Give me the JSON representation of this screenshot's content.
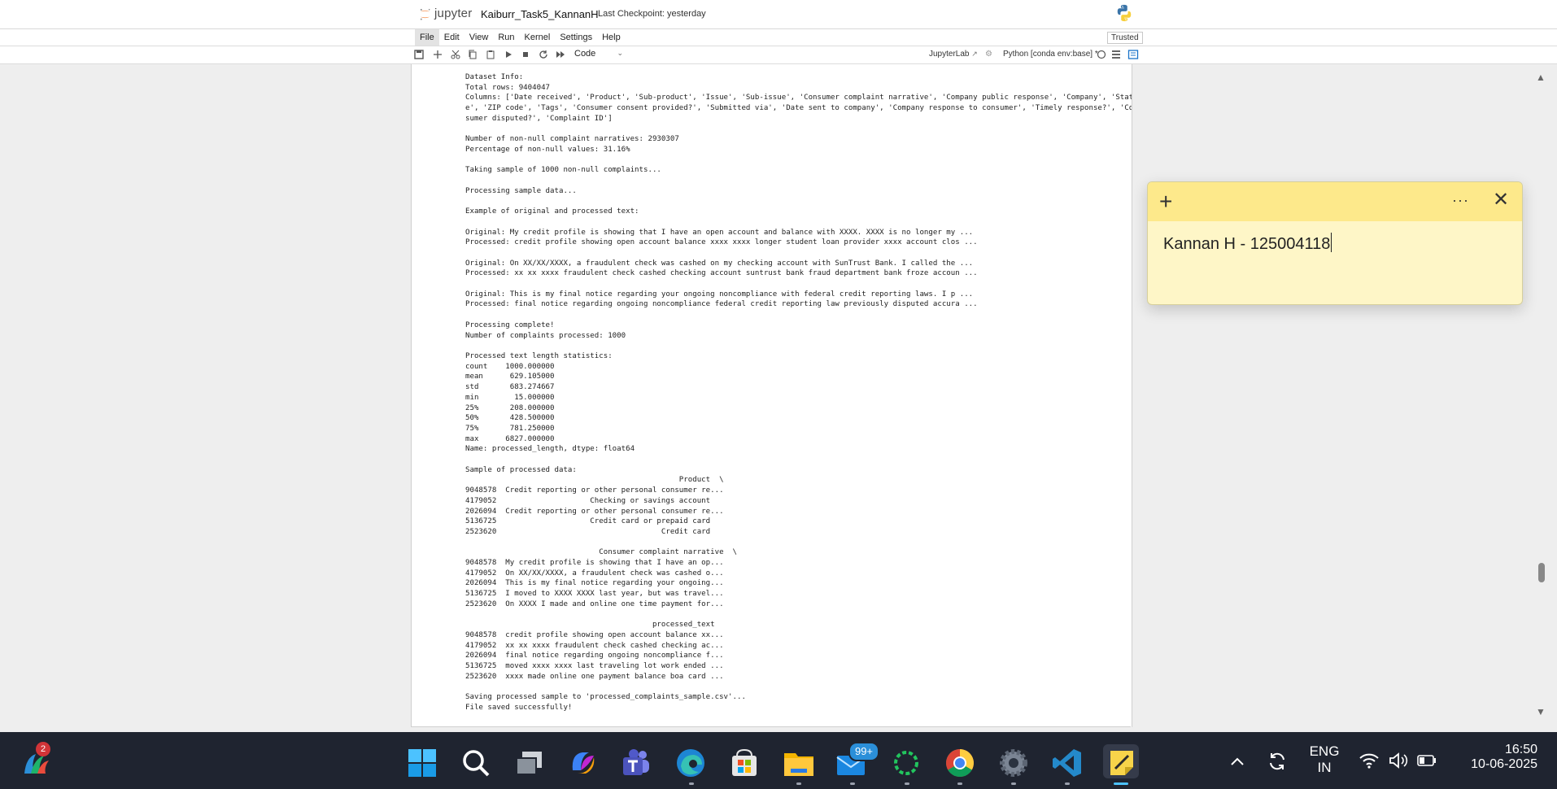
{
  "header": {
    "brand": "jupyter",
    "notebook_title": "Kaiburr_Task5_KannanH",
    "checkpoint": "Last Checkpoint: yesterday"
  },
  "menu": {
    "items": [
      "File",
      "Edit",
      "View",
      "Run",
      "Kernel",
      "Settings",
      "Help"
    ],
    "trusted": "Trusted"
  },
  "toolbar": {
    "cell_type": "Code",
    "jupyterlab_link": "JupyterLab",
    "kernel_name": "Python [conda env:base] *"
  },
  "output_text": "Dataset Info:\nTotal rows: 9404047\nColumns: ['Date received', 'Product', 'Sub-product', 'Issue', 'Sub-issue', 'Consumer complaint narrative', 'Company public response', 'Company', 'Stat\ne', 'ZIP code', 'Tags', 'Consumer consent provided?', 'Submitted via', 'Date sent to company', 'Company response to consumer', 'Timely response?', 'Con\nsumer disputed?', 'Complaint ID']\n\nNumber of non-null complaint narratives: 2930307\nPercentage of non-null values: 31.16%\n\nTaking sample of 1000 non-null complaints...\n\nProcessing sample data...\n\nExample of original and processed text:\n\nOriginal: My credit profile is showing that I have an open account and balance with XXXX. XXXX is no longer my ...\nProcessed: credit profile showing open account balance xxxx xxxx longer student loan provider xxxx account clos ...\n\nOriginal: On XX/XX/XXXX, a fraudulent check was cashed on my checking account with SunTrust Bank. I called the ...\nProcessed: xx xx xxxx fraudulent check cashed checking account suntrust bank fraud department bank froze accoun ...\n\nOriginal: This is my final notice regarding your ongoing noncompliance with federal credit reporting laws. I p ...\nProcessed: final notice regarding ongoing noncompliance federal credit reporting law previously disputed accura ...\n\nProcessing complete!\nNumber of complaints processed: 1000\n\nProcessed text length statistics:\ncount    1000.000000\nmean      629.105000\nstd       683.274667\nmin        15.000000\n25%       208.000000\n50%       428.500000\n75%       781.250000\nmax      6827.000000\nName: processed_length, dtype: float64\n\nSample of processed data:\n                                                Product  \\\n9048578  Credit reporting or other personal consumer re...\n4179052                     Checking or savings account\n2026094  Credit reporting or other personal consumer re...\n5136725                     Credit card or prepaid card\n2523620                                     Credit card\n\n                              Consumer complaint narrative  \\\n9048578  My credit profile is showing that I have an op...\n4179052  On XX/XX/XXXX, a fraudulent check was cashed o...\n2026094  This is my final notice regarding your ongoing...\n5136725  I moved to XXXX XXXX last year, but was travel...\n2523620  On XXXX I made and online one time payment for...\n\n                                          processed_text\n9048578  credit profile showing open account balance xx...\n4179052  xx xx xxxx fraudulent check cashed checking ac...\n2026094  final notice regarding ongoing noncompliance f...\n5136725  moved xxxx xxxx last traveling lot work ended ...\n2523620  xxxx made online one payment balance boa card ...\n\nSaving processed sample to 'processed_complaints_sample.csv'...\nFile saved successfully!",
  "sticky_note": {
    "text": "Kannan H - 125004118"
  },
  "taskbar": {
    "widget_badge": "2",
    "mail_badge": "99+",
    "language_line1": "ENG",
    "language_line2": "IN",
    "time": "16:50",
    "date": "10-06-2025"
  }
}
